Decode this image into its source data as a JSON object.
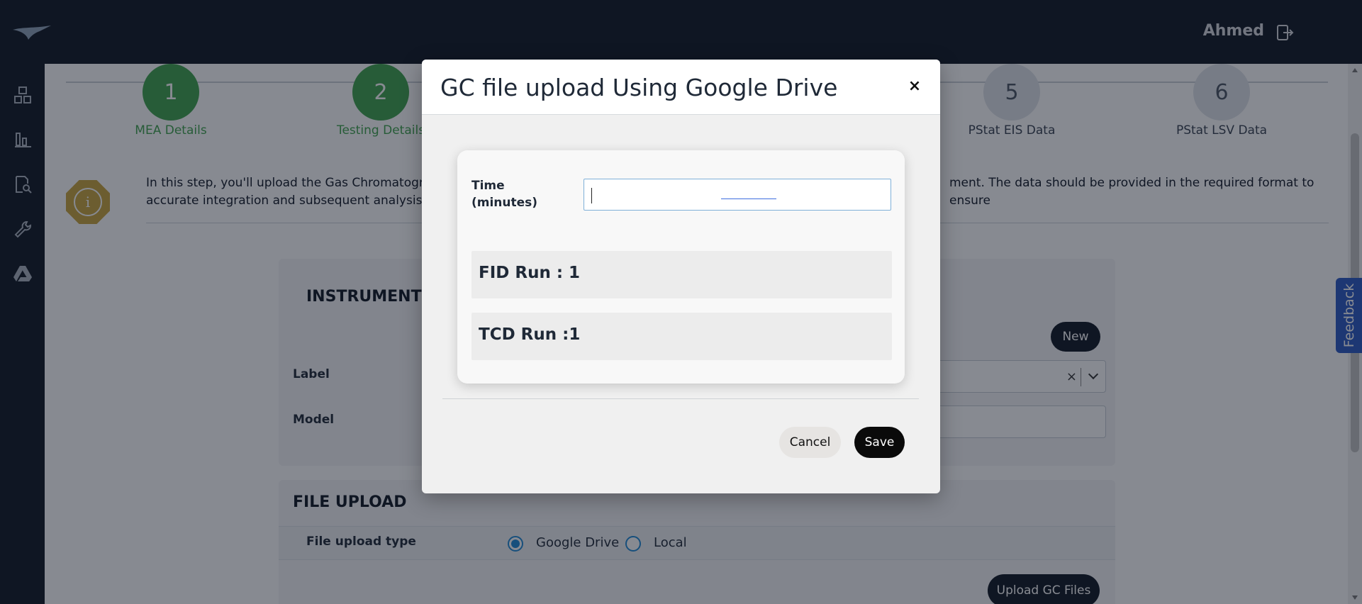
{
  "header": {
    "user_name": "Ahmed",
    "icons": [
      "logo-icon",
      "logout-icon"
    ]
  },
  "sidebar": {
    "icons": [
      "dashboard-icon",
      "chart-icon",
      "document-search-icon",
      "wrench-icon",
      "google-drive-icon"
    ]
  },
  "stepper": {
    "steps": [
      {
        "number": "1",
        "label": "MEA Details",
        "status": "done"
      },
      {
        "number": "2",
        "label": "Testing Details",
        "status": "done"
      },
      {
        "number": "5",
        "label": "PStat EIS Data",
        "status": "todo"
      },
      {
        "number": "6",
        "label": "PStat LSV Data",
        "status": "todo"
      }
    ]
  },
  "info": {
    "line1_left": "In this step, you'll upload the Gas Chromatograph",
    "line1_right": "ment. The data should be provided in the required format to ensure",
    "line2": "accurate integration and subsequent analysis. Ple"
  },
  "instrument": {
    "title": "INSTRUMENT D",
    "label_field": "Label",
    "model_field": "Model",
    "new_button": "New"
  },
  "file_upload": {
    "title": "FILE UPLOAD",
    "type_label": "File upload type",
    "options": [
      "Google Drive",
      "Local"
    ],
    "selected": "Google Drive",
    "upload_button": "Upload GC Files"
  },
  "feedback": {
    "label": "Feedback"
  },
  "modal": {
    "title": "GC file upload Using Google Drive",
    "close_symbol": "×",
    "time_label": "Time (minutes)",
    "time_value": "",
    "runs": [
      "FID Run : 1",
      "TCD Run :1"
    ],
    "cancel_label": "Cancel",
    "save_label": "Save"
  },
  "colors": {
    "dark": "#0f1623",
    "accent_green": "#3fa34d",
    "info_gold": "#c9a43c",
    "radio_blue": "#1e88d4",
    "feedback_blue": "#2b59c3"
  }
}
